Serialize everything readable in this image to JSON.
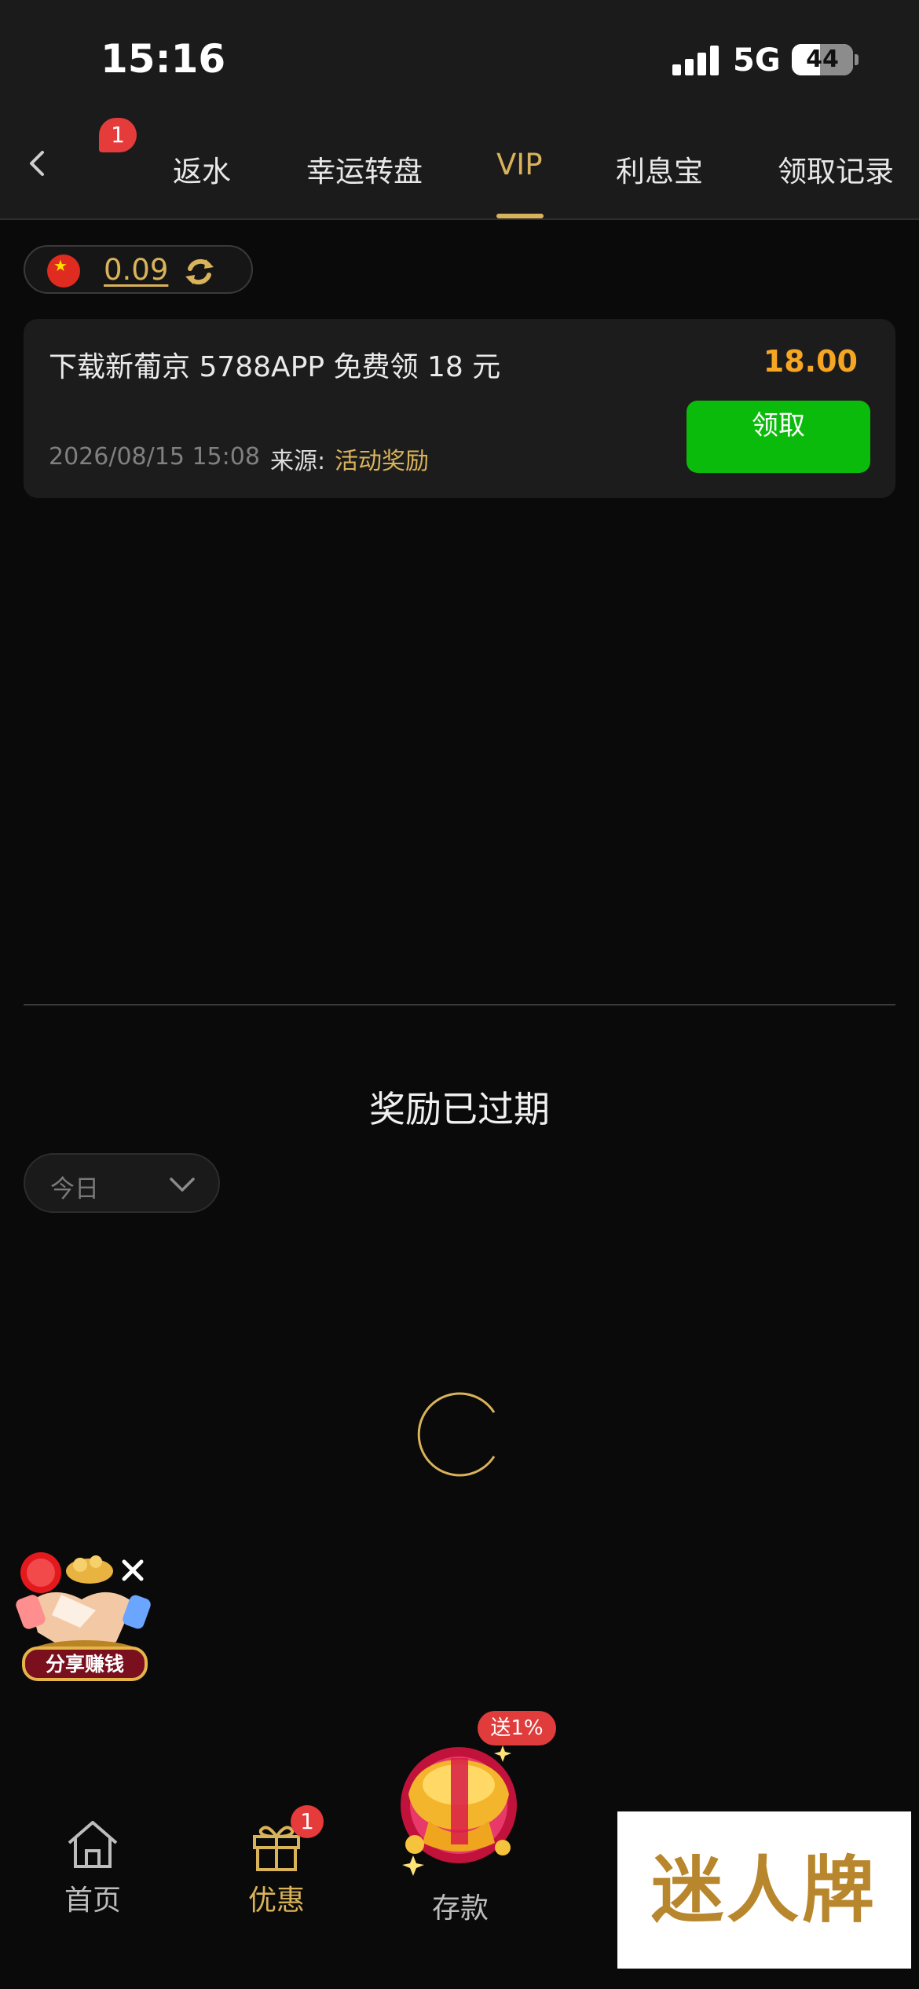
{
  "status_bar": {
    "time": "15:16",
    "network": "5G",
    "battery": "44"
  },
  "header": {
    "notification_count": "1",
    "tabs": [
      {
        "label": "返水"
      },
      {
        "label": "幸运转盘"
      },
      {
        "label": "VIP"
      },
      {
        "label": "利息宝"
      },
      {
        "label": "领取记录"
      }
    ],
    "active_tab": "VIP"
  },
  "balance": {
    "value": "0.09"
  },
  "reward_card": {
    "title": "下载新葡京 5788APP 免费领 18 元",
    "amount": "18.00",
    "datetime": "2026/08/15 15:08",
    "source_label": "来源:",
    "source_value": "活动奖励",
    "claim_label": "领取"
  },
  "status_message": "奖励已过期",
  "date_filter": {
    "selected": "今日"
  },
  "share_widget": {
    "label": "分享赚钱"
  },
  "bottom_nav": {
    "items": [
      {
        "label": "首页",
        "icon": "home-icon"
      },
      {
        "label": "优惠",
        "icon": "gift-icon",
        "badge": "1"
      },
      {
        "label": "存款",
        "icon": "gold-ingot-icon",
        "promo": "送1%"
      }
    ],
    "active": "优惠"
  },
  "watermark": {
    "text": "迷人牌"
  },
  "colors": {
    "accent": "#d9b35a",
    "amount": "#f5a623",
    "claim_button": "#0bbb0b",
    "badge": "#e53b3b"
  }
}
